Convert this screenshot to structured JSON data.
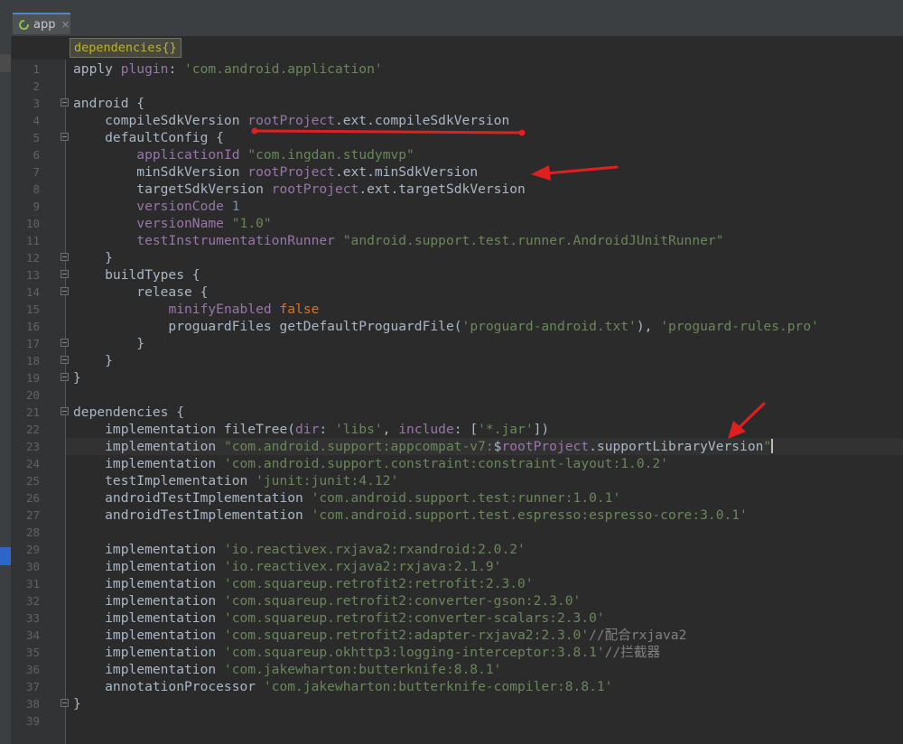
{
  "tab": {
    "label": "app",
    "close": "×",
    "icon": "android-gradle-icon"
  },
  "breadcrumb": "dependencies{}",
  "colors": {
    "plain": "#a9b7c6",
    "keyword": "#cc7832",
    "string": "#6a8759",
    "dsl_property": "#9876aa",
    "number": "#6897bb",
    "comment": "#808080",
    "annotation_arrow": "#e02020"
  },
  "lines": [
    [
      [
        "apply ",
        "p"
      ],
      [
        "plugin",
        "v"
      ],
      [
        ": ",
        "p"
      ],
      [
        "'com.android.application'",
        "s"
      ]
    ],
    [],
    [
      [
        "android {",
        "p"
      ]
    ],
    [
      [
        "    compileSdkVersion ",
        "p"
      ],
      [
        "rootProject",
        "v"
      ],
      [
        ".ext.compileSdkVersion",
        "p"
      ]
    ],
    [
      [
        "    defaultConfig {",
        "p"
      ]
    ],
    [
      [
        "        ",
        "p"
      ],
      [
        "applicationId",
        "v"
      ],
      [
        " ",
        "p"
      ],
      [
        "\"com.ingdan.studymvp\"",
        "s"
      ]
    ],
    [
      [
        "        minSdkVersion ",
        "p"
      ],
      [
        "rootProject",
        "v"
      ],
      [
        ".ext.minSdkVersion",
        "p"
      ]
    ],
    [
      [
        "        targetSdkVersion ",
        "p"
      ],
      [
        "rootProject",
        "v"
      ],
      [
        ".ext.targetSdkVersion",
        "p"
      ]
    ],
    [
      [
        "        ",
        "p"
      ],
      [
        "versionCode",
        "v"
      ],
      [
        " ",
        "p"
      ],
      [
        "1",
        "n"
      ]
    ],
    [
      [
        "        ",
        "p"
      ],
      [
        "versionName",
        "v"
      ],
      [
        " ",
        "p"
      ],
      [
        "\"1.0\"",
        "s"
      ]
    ],
    [
      [
        "        ",
        "p"
      ],
      [
        "testInstrumentationRunner",
        "v"
      ],
      [
        " ",
        "p"
      ],
      [
        "\"android.support.test.runner.AndroidJUnitRunner\"",
        "s"
      ]
    ],
    [
      [
        "    }",
        "p"
      ]
    ],
    [
      [
        "    buildTypes {",
        "p"
      ]
    ],
    [
      [
        "        release {",
        "p"
      ]
    ],
    [
      [
        "            ",
        "p"
      ],
      [
        "minifyEnabled",
        "v"
      ],
      [
        " ",
        "p"
      ],
      [
        "false",
        "k"
      ]
    ],
    [
      [
        "            proguardFiles getDefaultProguardFile(",
        "p"
      ],
      [
        "'proguard-android.txt'",
        "s"
      ],
      [
        "), ",
        "p"
      ],
      [
        "'proguard-rules.pro'",
        "s"
      ]
    ],
    [
      [
        "        }",
        "p"
      ]
    ],
    [
      [
        "    }",
        "p"
      ]
    ],
    [
      [
        "}",
        "p"
      ]
    ],
    [],
    [
      [
        "dependencies {",
        "p"
      ]
    ],
    [
      [
        "    implementation fileTree(",
        "p"
      ],
      [
        "dir",
        "v"
      ],
      [
        ": ",
        "p"
      ],
      [
        "'libs'",
        "s"
      ],
      [
        ", ",
        "p"
      ],
      [
        "include",
        "v"
      ],
      [
        ": [",
        "p"
      ],
      [
        "'*.jar'",
        "s"
      ],
      [
        "])",
        "p"
      ]
    ],
    [
      [
        "    implementation ",
        "p"
      ],
      [
        "\"com.android.support:appcompat-v7:",
        "s"
      ],
      [
        "$",
        "p"
      ],
      [
        "rootProject",
        "v"
      ],
      [
        ".supportLibraryVersion",
        "p"
      ],
      [
        "\"",
        "s"
      ]
    ],
    [
      [
        "    implementation ",
        "p"
      ],
      [
        "'com.android.support.constraint:constraint-layout:1.0.2'",
        "s"
      ]
    ],
    [
      [
        "    testImplementation ",
        "p"
      ],
      [
        "'junit:junit:4.12'",
        "s"
      ]
    ],
    [
      [
        "    androidTestImplementation ",
        "p"
      ],
      [
        "'com.android.support.test:runner:1.0.1'",
        "s"
      ]
    ],
    [
      [
        "    androidTestImplementation ",
        "p"
      ],
      [
        "'com.android.support.test.espresso:espresso-core:3.0.1'",
        "s"
      ]
    ],
    [],
    [
      [
        "    implementation ",
        "p"
      ],
      [
        "'io.reactivex.rxjava2:rxandroid:2.0.2'",
        "s"
      ]
    ],
    [
      [
        "    implementation ",
        "p"
      ],
      [
        "'io.reactivex.rxjava2:rxjava:2.1.9'",
        "s"
      ]
    ],
    [
      [
        "    implementation ",
        "p"
      ],
      [
        "'com.squareup.retrofit2:retrofit:2.3.0'",
        "s"
      ]
    ],
    [
      [
        "    implementation ",
        "p"
      ],
      [
        "'com.squareup.retrofit2:converter-gson:2.3.0'",
        "s"
      ]
    ],
    [
      [
        "    implementation ",
        "p"
      ],
      [
        "'com.squareup.retrofit2:converter-scalars:2.3.0'",
        "s"
      ]
    ],
    [
      [
        "    implementation ",
        "p"
      ],
      [
        "'com.squareup.retrofit2:adapter-rxjava2:2.3.0'",
        "s"
      ],
      [
        "//配合rxjava2",
        "c"
      ]
    ],
    [
      [
        "    implementation ",
        "p"
      ],
      [
        "'com.squareup.okhttp3:logging-interceptor:3.8.1'",
        "s"
      ],
      [
        "//拦截器",
        "c"
      ]
    ],
    [
      [
        "    implementation ",
        "p"
      ],
      [
        "'com.jakewharton:butterknife:8.8.1'",
        "s"
      ]
    ],
    [
      [
        "    annotationProcessor ",
        "p"
      ],
      [
        "'com.jakewharton:butterknife-compiler:8.8.1'",
        "s"
      ]
    ],
    [
      [
        "}",
        "p"
      ]
    ],
    []
  ],
  "fold_lines": [
    3,
    5,
    12,
    13,
    14,
    17,
    18,
    19,
    21,
    38
  ],
  "current_line": 23
}
